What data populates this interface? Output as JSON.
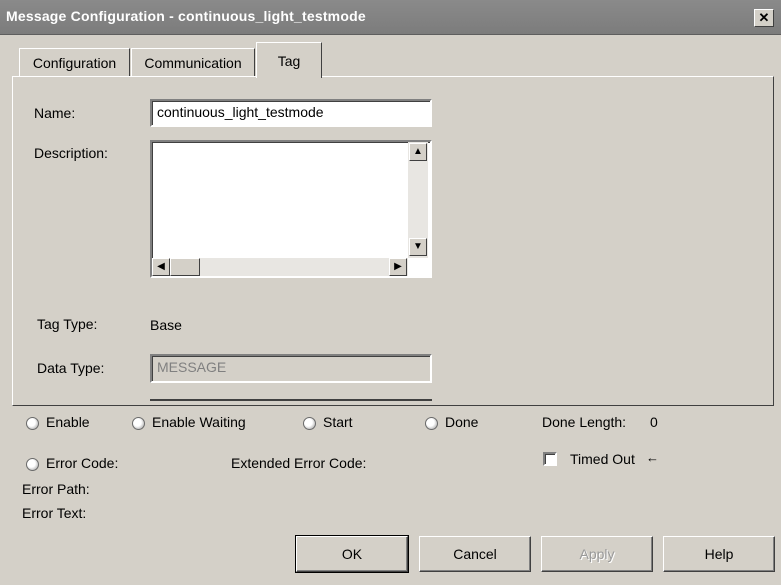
{
  "window": {
    "title": "Message Configuration - continuous_light_testmode",
    "close_glyph": "✕"
  },
  "tabs": [
    {
      "label": "Configuration",
      "active": false
    },
    {
      "label": "Communication",
      "active": false
    },
    {
      "label": "Tag",
      "active": true
    }
  ],
  "tag_panel": {
    "name_label": "Name:",
    "name_value": "continuous_light_testmode",
    "description_label": "Description:",
    "description_value": "",
    "tag_type_label": "Tag Type:",
    "tag_type_value": "Base",
    "data_type_label": "Data Type:",
    "data_type_value": "MESSAGE"
  },
  "status": {
    "enable": "Enable",
    "enable_waiting": "Enable Waiting",
    "start": "Start",
    "done": "Done",
    "done_length_label": "Done Length:",
    "done_length_value": "0",
    "error_code": "Error Code:",
    "extended_error_code": "Extended Error Code:",
    "timed_out": "Timed Out",
    "timed_out_arrow": "←",
    "error_path": "Error Path:",
    "error_text": "Error Text:"
  },
  "buttons": {
    "ok": "OK",
    "cancel": "Cancel",
    "apply": "Apply",
    "help": "Help"
  },
  "icons": {
    "arrow_up": "▲",
    "arrow_down": "▼",
    "arrow_left": "◀",
    "arrow_right": "▶"
  },
  "colors": {
    "titlebar": "#7c7c7c",
    "face": "#d4d0c8"
  }
}
